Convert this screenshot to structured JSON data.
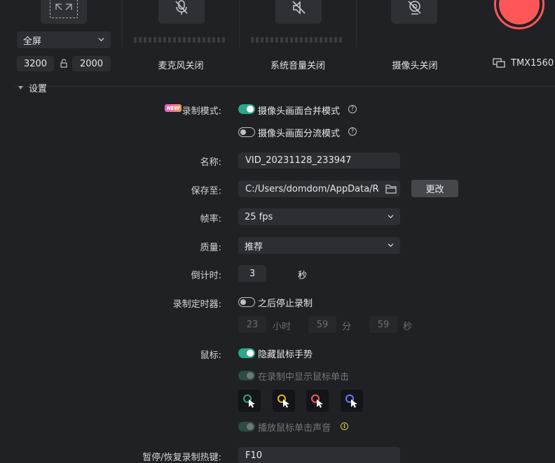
{
  "source": {
    "mode": "全屏",
    "width": "3200",
    "height": "2000"
  },
  "devices": [
    {
      "label": "麦克风关闭",
      "icon": "mic-off-icon"
    },
    {
      "label": "系统音量关闭",
      "icon": "speaker-off-icon"
    },
    {
      "label": "摄像头关闭",
      "icon": "camera-off-icon"
    }
  ],
  "monitor": {
    "label": "TMX1560",
    "icon": "monitor-icon"
  },
  "settings": {
    "title": "设置",
    "record_mode": {
      "badge": "NEW",
      "label": "录制模式:",
      "option_merge": "摄像头画面合并模式",
      "option_split": "摄像头画面分流模式"
    },
    "name": {
      "label": "名称:",
      "value": "VID_20231128_233947"
    },
    "save_to": {
      "label": "保存至:",
      "value": "C:/Users/domdom/AppData/Roaming",
      "button": "更改"
    },
    "frame_rate": {
      "label": "帧率:",
      "value": "25 fps"
    },
    "quality": {
      "label": "质量:",
      "value": "推荐"
    },
    "countdown": {
      "label": "倒计时:",
      "value": "3",
      "unit": "秒"
    },
    "timer": {
      "label": "录制定时器:",
      "option": "之后停止录制",
      "hours": "23",
      "hours_unit": "小时",
      "minutes": "59",
      "minutes_unit": "分",
      "seconds": "59",
      "seconds_unit": "秒"
    },
    "mouse": {
      "label": "鼠标:",
      "hide_cursor": "隐藏鼠标手势",
      "show_clicks": "在录制中显示鼠标单击",
      "click_sound": "播放鼠标单击声音",
      "cursor_colors": [
        "#2aa889",
        "#f0b429",
        "#ff5a5a",
        "#6b7bff"
      ]
    },
    "hotkey": {
      "label": "暂停/恢复录制热键:",
      "value": "F10"
    }
  },
  "colors": {
    "accent": "#2aa889",
    "record": "#ff5757",
    "background": "#202124"
  }
}
